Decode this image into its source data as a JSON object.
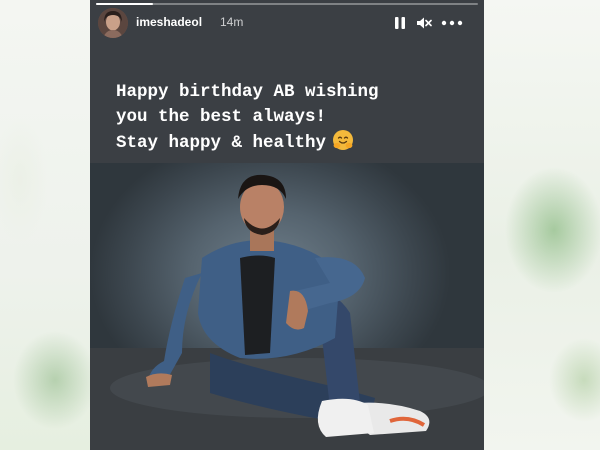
{
  "story": {
    "username": "imeshadeol",
    "time_ago": "14m",
    "progress": 0.15,
    "caption_lines": [
      "Happy birthday AB wishing",
      "you the best always!",
      "Stay happy & healthy"
    ],
    "caption_emoji": "hugging-face-emoji",
    "controls": {
      "pause_icon": "pause-icon",
      "mute_icon": "volume-muted-icon",
      "more_icon": "more-options-icon"
    },
    "colors": {
      "background": "#3b3f44",
      "text": "#ffffff",
      "photo_backdrop": "#55636e"
    }
  }
}
